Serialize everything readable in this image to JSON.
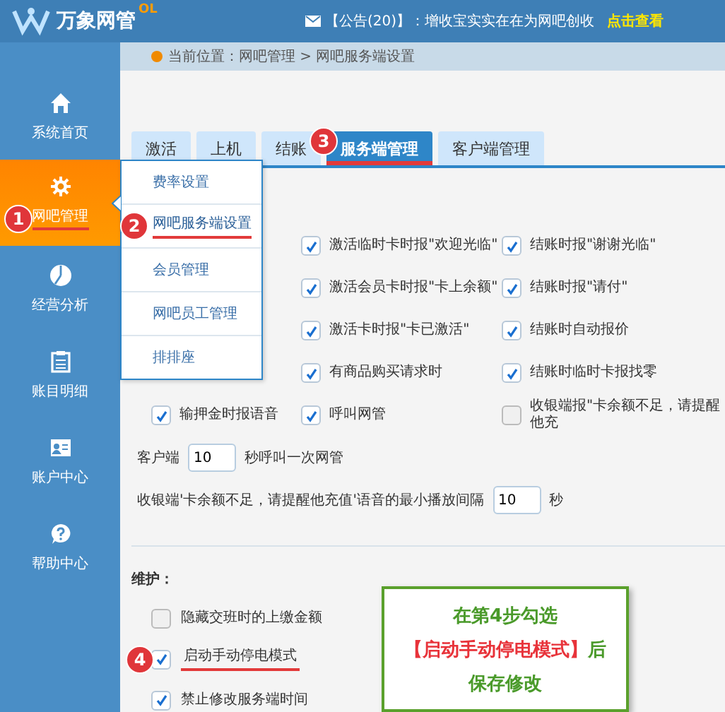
{
  "header": {
    "logo_text": "万象网管",
    "logo_badge": "OL",
    "notice": "【公告(20)】：增收宝实实在在为网吧创收",
    "notice_link": "点击查看"
  },
  "breadcrumb": "当前位置：网吧管理 > 网吧服务端设置",
  "sidebar": {
    "items": [
      {
        "label": "系统首页",
        "selected": false
      },
      {
        "label": "网吧管理",
        "selected": true,
        "step": "1"
      },
      {
        "label": "经营分析",
        "selected": false
      },
      {
        "label": "账目明细",
        "selected": false
      },
      {
        "label": "账户中心",
        "selected": false
      },
      {
        "label": "帮助中心",
        "selected": false
      }
    ]
  },
  "submenu": {
    "items": [
      {
        "label": "费率设置",
        "selected": false
      },
      {
        "label": "网吧服务端设置",
        "selected": true,
        "step": "2"
      },
      {
        "label": "会员管理",
        "selected": false
      },
      {
        "label": "网吧员工管理",
        "selected": false
      },
      {
        "label": "排排座",
        "selected": false
      }
    ]
  },
  "tabs": [
    {
      "label": "激活",
      "selected": false
    },
    {
      "label": "上机",
      "selected": false
    },
    {
      "label": "结账",
      "selected": false
    },
    {
      "label": "服务端管理",
      "selected": true,
      "step": "3"
    },
    {
      "label": "客户端管理",
      "selected": false
    }
  ],
  "option_rows": [
    {
      "items": [
        {
          "label": "激活临时卡时报\"欢迎光临\"",
          "checked": true
        },
        {
          "label": "结账时报\"谢谢光临\"",
          "checked": true
        }
      ]
    },
    {
      "items": [
        {
          "label": "激活会员卡时报\"卡上余额\"",
          "checked": true
        },
        {
          "label": "结账时报\"请付\"",
          "checked": true
        }
      ]
    },
    {
      "items": [
        {
          "label": "激活卡时报\"卡已激活\"",
          "checked": true
        },
        {
          "label": "结账时自动报价",
          "checked": true
        }
      ]
    },
    {
      "items": [
        {
          "label": "有商品购买请求时",
          "checked": true
        },
        {
          "label": "结账时临时卡报找零",
          "checked": true
        }
      ]
    },
    {
      "items": [
        {
          "label": "输押金时报语音",
          "checked": true
        },
        {
          "label": "呼叫网管",
          "checked": true
        },
        {
          "label": "收银端报\"卡余额不足，请提醒他充",
          "checked": false
        }
      ]
    }
  ],
  "interval_fields": [
    {
      "before": "客户端",
      "value": "10",
      "after": "秒呼叫一次网管"
    },
    {
      "before": "收银端'卡余额不足，请提醒他充值'语音的最小播放间隔",
      "value": "10",
      "after": "秒"
    }
  ],
  "maintenance": {
    "title": "维护：",
    "options": [
      {
        "label": "隐藏交班时的上缴金额",
        "checked": false
      },
      {
        "label": "启动手动停电模式",
        "checked": true,
        "step": "4"
      },
      {
        "label": "禁止修改服务端时间",
        "checked": true
      }
    ]
  },
  "callout": {
    "lines": [
      [
        {
          "text": "在第4步勾选",
          "kind": "plain"
        }
      ],
      [
        {
          "text": "【启动手动停电模式】",
          "kind": "highlight"
        },
        {
          "text": "后",
          "kind": "plain"
        }
      ],
      [
        {
          "text": "保存修改",
          "kind": "plain"
        }
      ]
    ]
  }
}
